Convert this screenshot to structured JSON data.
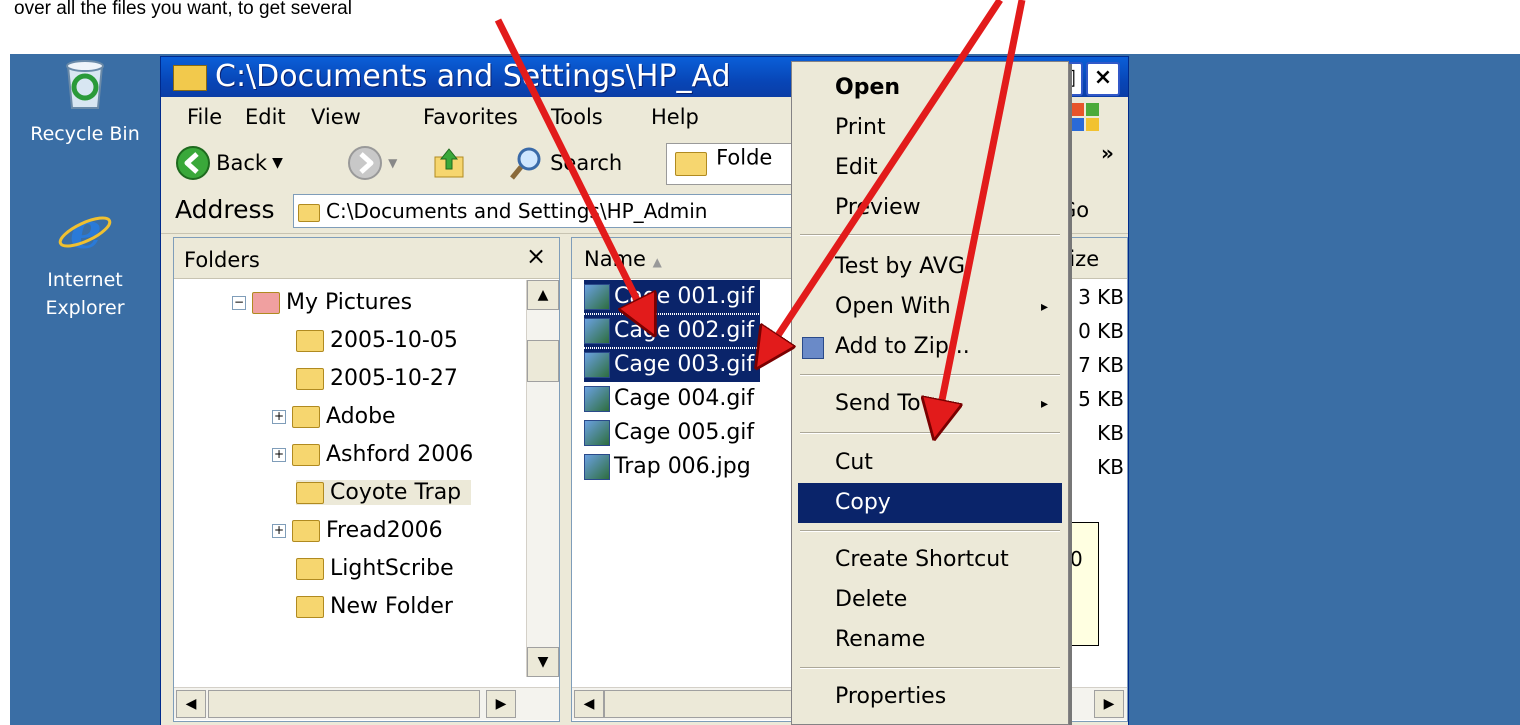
{
  "caption": "over all the files you want, to get several",
  "desktop": {
    "icons": [
      {
        "label": "Recycle Bin",
        "icon": "recycle-bin-icon"
      },
      {
        "label": "Internet Explorer",
        "icon": "internet-explorer-icon"
      }
    ],
    "ie_line1": "Internet",
    "ie_line2": "Explorer"
  },
  "window": {
    "title": "C:\\Documents and Settings\\HP_Ad",
    "restore_glyph": "□",
    "close_glyph": "×",
    "menu": [
      "File",
      "Edit",
      "View",
      "Favorites",
      "Tools",
      "Help"
    ],
    "toolbar": {
      "back": "Back",
      "search": "Search",
      "folders": "Folde",
      "more": "»"
    },
    "address": {
      "label": "Address",
      "value": "C:\\Documents and Settings\\HP_Admin",
      "go": "Go"
    }
  },
  "folders_pane": {
    "header": "Folders",
    "close": "×",
    "items": [
      {
        "label": "My Pictures",
        "expander": "−"
      },
      {
        "label": "2005-10-05",
        "expander": ""
      },
      {
        "label": "2005-10-27",
        "expander": ""
      },
      {
        "label": "Adobe",
        "expander": "+"
      },
      {
        "label": "Ashford 2006",
        "expander": "+"
      },
      {
        "label": "Coyote Trap",
        "expander": ""
      },
      {
        "label": "Fread2006",
        "expander": "+"
      },
      {
        "label": "LightScribe",
        "expander": ""
      },
      {
        "label": "New Folder",
        "expander": ""
      }
    ]
  },
  "file_list": {
    "columns": {
      "name": "Name",
      "size": "Size"
    },
    "files": [
      {
        "name": "Cage 001.gif",
        "size": "3 KB",
        "selected": true
      },
      {
        "name": "Cage 002.gif",
        "size": "0 KB",
        "selected": true
      },
      {
        "name": "Cage 003.gif",
        "size": "7 KB",
        "selected": true
      },
      {
        "name": "Cage 004.gif",
        "size": "5 KB",
        "selected": false
      },
      {
        "name": "Cage 005.gif",
        "size": "KB",
        "selected": false
      },
      {
        "name": "Trap 006.jpg",
        "size": "KB",
        "selected": false
      }
    ],
    "tooltip_fragment": "0"
  },
  "context_menu": {
    "items": [
      {
        "label": "Open",
        "bold": true
      },
      {
        "label": "Print"
      },
      {
        "label": "Edit"
      },
      {
        "label": "Preview"
      },
      {
        "label": "Test by AVG"
      },
      {
        "label": "Open With",
        "submenu": "▸"
      },
      {
        "label": "Add to Zip..."
      },
      {
        "label": "Send To",
        "submenu": "▸"
      },
      {
        "label": "Cut"
      },
      {
        "label": "Copy",
        "highlighted": true
      },
      {
        "label": "Create Shortcut"
      },
      {
        "label": "Delete"
      },
      {
        "label": "Rename"
      },
      {
        "label": "Properties"
      }
    ]
  },
  "colors": {
    "desktop": "#3a6ea5",
    "selection": "#0a246a",
    "arrow": "#e21b1b"
  }
}
